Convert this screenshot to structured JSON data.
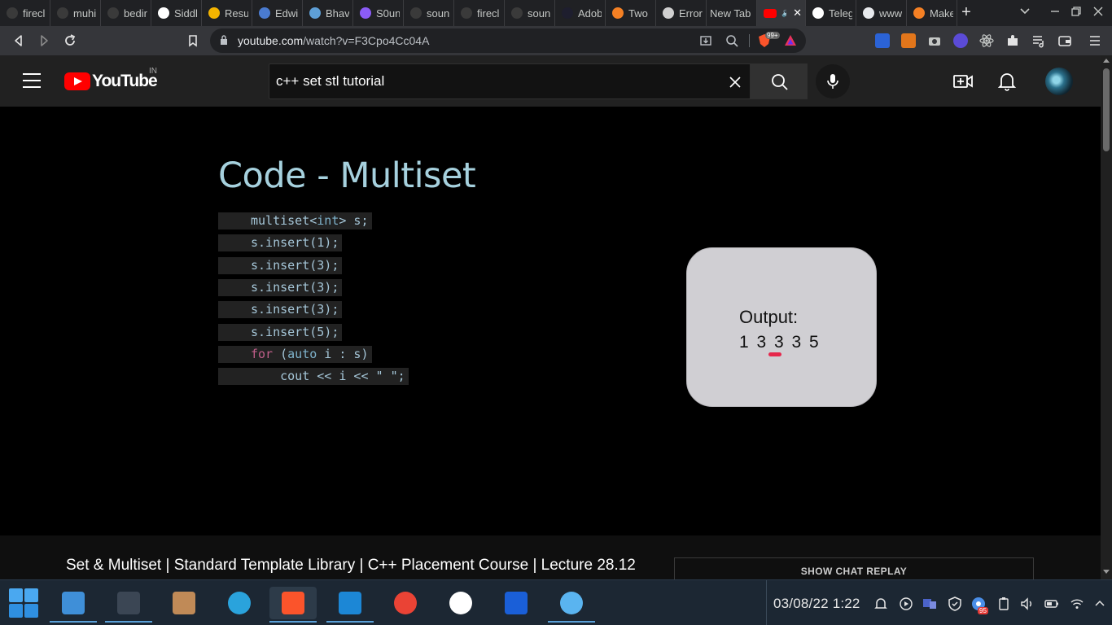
{
  "browser": {
    "tabs": [
      {
        "title": "firecl",
        "favicon": "github-icon",
        "color": "#3a3a3a"
      },
      {
        "title": "muhi",
        "favicon": "github-icon",
        "color": "#3a3a3a"
      },
      {
        "title": "bedir",
        "favicon": "github-icon",
        "color": "#3a3a3a"
      },
      {
        "title": "Siddl",
        "favicon": "sv-icon",
        "color": "#ffffff"
      },
      {
        "title": "Resu",
        "favicon": "google-drive-icon",
        "color": "#f4b400"
      },
      {
        "title": "Edwi",
        "favicon": "bookmark-book-icon",
        "color": "#4a7bd0"
      },
      {
        "title": "Bhav",
        "favicon": "globe-icon",
        "color": "#5e9fd6"
      },
      {
        "title": "S0un",
        "favicon": "fingerprint-icon",
        "color": "#8b5cf6"
      },
      {
        "title": "soun",
        "favicon": "github-icon",
        "color": "#3a3a3a"
      },
      {
        "title": "firecl",
        "favicon": "github-icon",
        "color": "#3a3a3a"
      },
      {
        "title": "soun",
        "favicon": "github-icon",
        "color": "#3a3a3a"
      },
      {
        "title": "Adob",
        "favicon": "infinity-icon",
        "color": "#1e1e2e"
      },
      {
        "title": "Two",
        "favicon": "stack-icon",
        "color": "#f48024"
      },
      {
        "title": "Error",
        "favicon": "cc-icon",
        "color": "#d0d0d0"
      },
      {
        "title": "New Tab",
        "favicon": "",
        "color": ""
      },
      {
        "title": "",
        "favicon": "youtube-icon",
        "color": "#ff0000",
        "active": true
      },
      {
        "title": "Teleg",
        "favicon": "globe-icon",
        "color": "#ffffff"
      },
      {
        "title": "www",
        "favicon": "google-icon",
        "color": "#e8eaed"
      },
      {
        "title": "Make",
        "favicon": "stack-icon",
        "color": "#f48024"
      }
    ],
    "url_host": "youtube.com",
    "url_path": "/watch?v=F3Cpo4Cc04A",
    "brave_badge": "99+"
  },
  "youtube": {
    "logo_text": "YouTube",
    "country_code": "IN",
    "search_value": "c++ set stl tutorial"
  },
  "slide": {
    "title": "Code - Multiset",
    "code": [
      {
        "segments": [
          {
            "t": "multiset",
            "c": ""
          },
          {
            "t": "<",
            "c": ""
          },
          {
            "t": "int",
            "c": "kw"
          },
          {
            "t": "> s;",
            "c": ""
          }
        ]
      },
      {
        "segments": [
          {
            "t": "s.insert(1);",
            "c": ""
          }
        ]
      },
      {
        "segments": [
          {
            "t": "s.insert(3);",
            "c": ""
          }
        ]
      },
      {
        "segments": [
          {
            "t": "s.insert(3);",
            "c": ""
          }
        ]
      },
      {
        "segments": [
          {
            "t": "s.insert(3);",
            "c": ""
          }
        ]
      },
      {
        "segments": [
          {
            "t": "s.insert(5);",
            "c": ""
          }
        ]
      },
      {
        "segments": [
          {
            "t": "for",
            "c": "pk"
          },
          {
            "t": " (",
            "c": ""
          },
          {
            "t": "auto",
            "c": "kw"
          },
          {
            "t": " i : s)",
            "c": ""
          }
        ]
      },
      {
        "segments": [
          {
            "t": "    cout << i << \" \";",
            "c": ""
          }
        ]
      }
    ],
    "output_label": "Output:",
    "output_values": "1 3 3 3 5"
  },
  "video_title": "Set & Multiset | Standard Template Library | C++ Placement Course | Lecture 28.12",
  "chat_replay_label": "SHOW CHAT REPLAY",
  "taskbar": {
    "apps": [
      {
        "name": "file-explorer",
        "icon": "folder-icon",
        "color": "#3f8fd8",
        "running": true
      },
      {
        "name": "terminal",
        "icon": "terminal-icon",
        "color": "#3b4654",
        "running": true
      },
      {
        "name": "minecraft",
        "icon": "grass-block-icon",
        "color": "#c08a57",
        "running": false
      },
      {
        "name": "telegram",
        "icon": "telegram-icon",
        "color": "#2aa3dc",
        "running": false
      },
      {
        "name": "brave",
        "icon": "brave-lion-icon",
        "color": "#fb542b",
        "running": true,
        "active": true
      },
      {
        "name": "vscode",
        "icon": "vscode-icon",
        "color": "#1c87d6",
        "running": true
      },
      {
        "name": "chrome",
        "icon": "chrome-icon",
        "color": "#ea4335",
        "running": false
      },
      {
        "name": "notion-like",
        "icon": "w-app-icon",
        "color": "#ffffff",
        "running": false
      },
      {
        "name": "brave-beta",
        "icon": "brave-beta-icon",
        "color": "#1a5fd8",
        "running": false
      },
      {
        "name": "edge-dev",
        "icon": "swift-icon",
        "color": "#5ab4f0",
        "running": true
      }
    ],
    "clock": "03/08/22  1:22",
    "tray_badge": "95"
  }
}
